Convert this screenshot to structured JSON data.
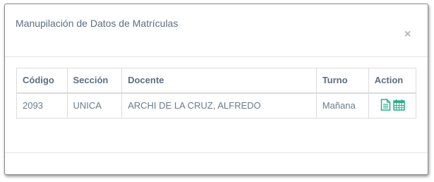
{
  "modal": {
    "title": "Manupilación de Datos de Matrículas",
    "close_label": "×"
  },
  "table": {
    "headers": [
      "Código",
      "Sección",
      "Docente",
      "Turno",
      "Action"
    ],
    "rows": [
      {
        "codigo": "2093",
        "seccion": "UNICA",
        "docente": "ARCHI DE LA CRUZ, ALFREDO",
        "turno": "Mañana",
        "actions": [
          "document-icon",
          "calendar-icon"
        ]
      }
    ]
  },
  "colors": {
    "action_icon": "#26b08a",
    "title_text": "#5b6f82"
  }
}
